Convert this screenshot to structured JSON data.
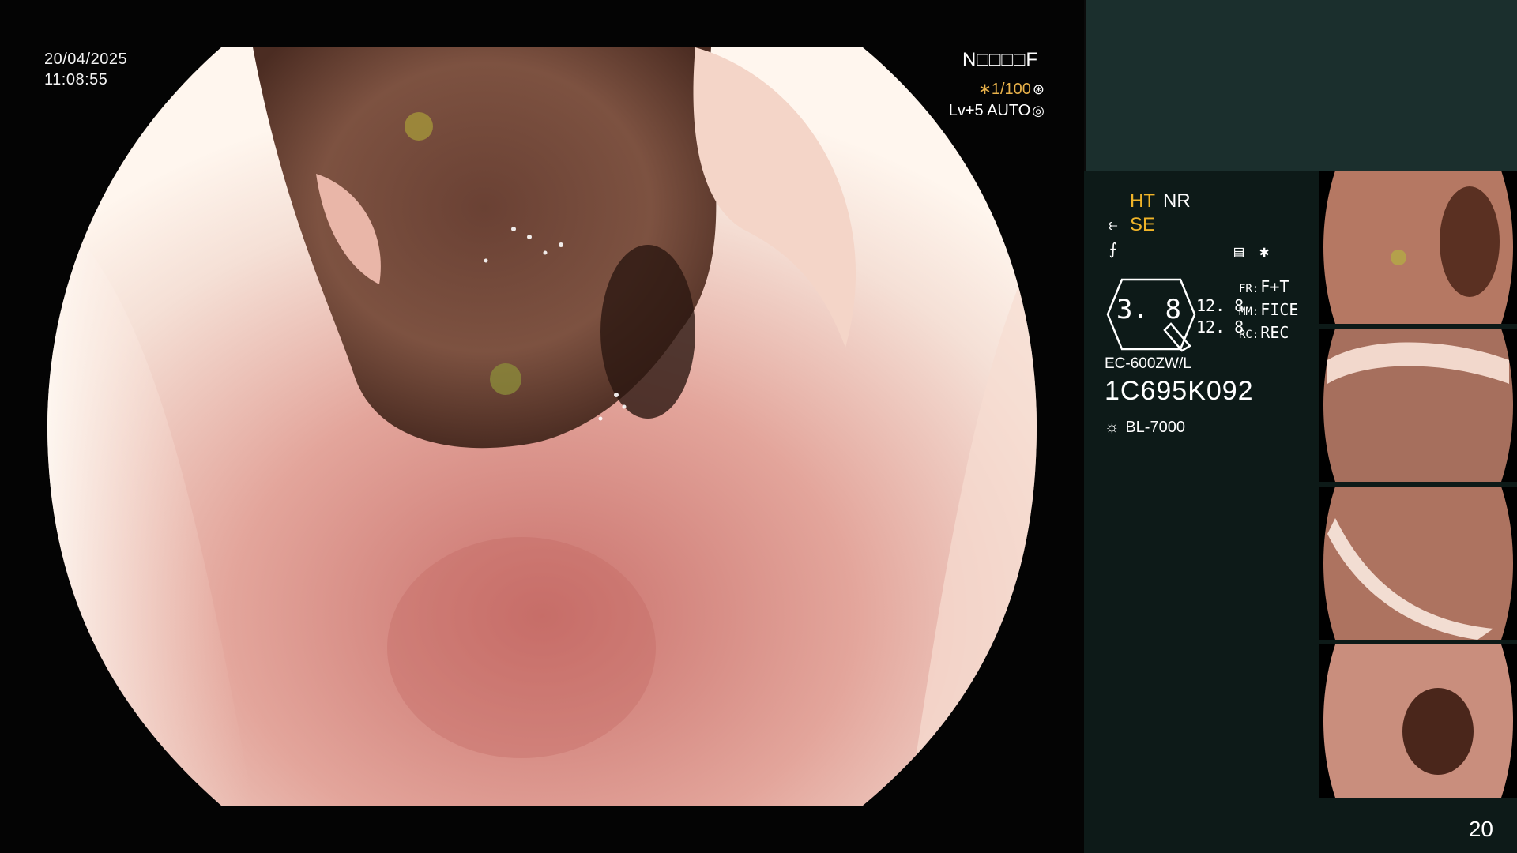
{
  "timestamp": {
    "date": "20/04/2025",
    "time": "11:08:55"
  },
  "overlay": {
    "patient_id": "N□□□□F",
    "shutter": "∗1/100",
    "shutter_icon": "aperture-icon",
    "level": "Lv+5 AUTO",
    "level_icon": "iris-icon"
  },
  "panel": {
    "mode_row1": [
      "HT",
      "NR"
    ],
    "mode_row2": "SE",
    "hex_value": "3. 8",
    "mini_values": [
      "12. 8",
      "12. 8"
    ],
    "fr": {
      "label": "FR:",
      "value": "F+T"
    },
    "mm": {
      "label": "MM:",
      "value": "FICE"
    },
    "rc": {
      "label": "RC:",
      "value": "REC"
    },
    "scope_model": "EC-600ZW/L",
    "serial": "1C695K092",
    "light_source": "BL-7000",
    "page_number": "20"
  },
  "colors": {
    "accent_yellow": "#f0b429",
    "panel_bg": "#0d1a18",
    "panel_top": "#1b2f2d"
  }
}
